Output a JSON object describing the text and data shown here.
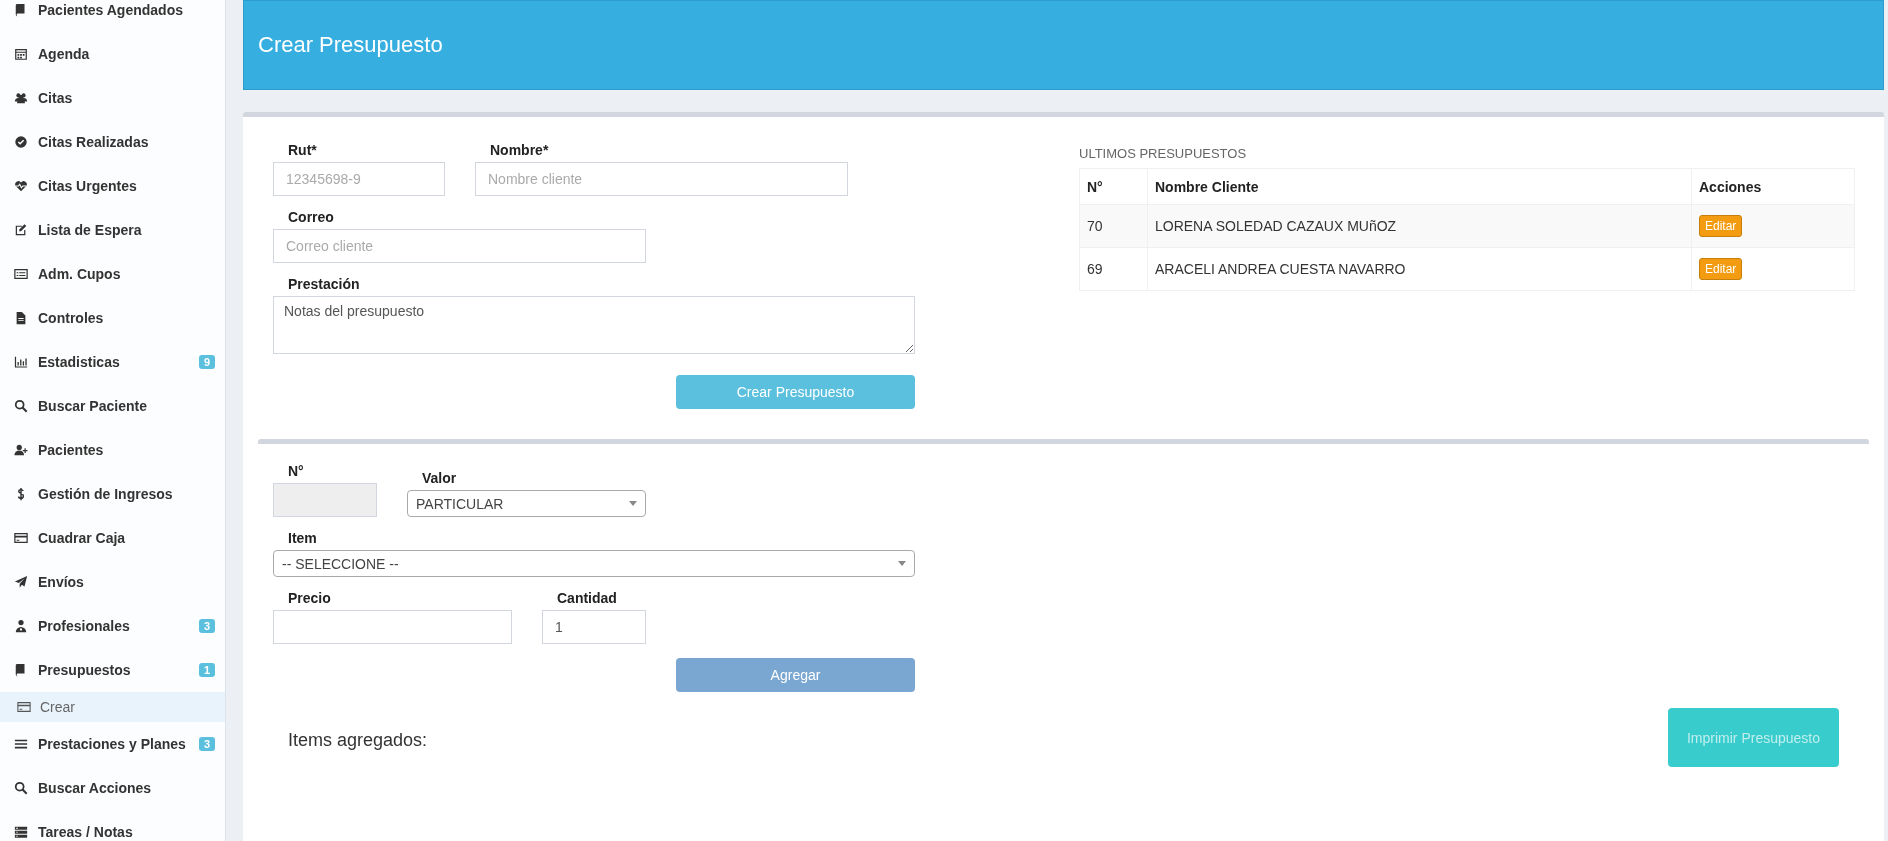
{
  "sidebar": {
    "items": [
      {
        "label": "Pacientes Agendados",
        "kind": "main",
        "selected": false
      },
      {
        "label": "Agenda",
        "kind": "main",
        "selected": false
      },
      {
        "label": "Citas",
        "kind": "main",
        "selected": false
      },
      {
        "label": "Citas Realizadas",
        "kind": "main",
        "selected": false
      },
      {
        "label": "Citas Urgentes",
        "kind": "main",
        "selected": false
      },
      {
        "label": "Lista de Espera",
        "kind": "main",
        "selected": false
      },
      {
        "label": "Adm. Cupos",
        "kind": "main",
        "selected": false
      },
      {
        "label": "Controles",
        "kind": "main",
        "selected": false
      },
      {
        "label": "Estadisticas",
        "kind": "main",
        "selected": false,
        "badge": "9"
      },
      {
        "label": "Buscar Paciente",
        "kind": "main",
        "selected": false
      },
      {
        "label": "Pacientes",
        "kind": "main",
        "selected": false
      },
      {
        "label": "Gestión de Ingresos",
        "kind": "main",
        "selected": false
      },
      {
        "label": "Cuadrar Caja",
        "kind": "main",
        "selected": false
      },
      {
        "label": "Envíos",
        "kind": "main",
        "selected": false
      },
      {
        "label": "Profesionales",
        "kind": "main",
        "selected": false,
        "badge": "3"
      },
      {
        "label": "Presupuestos",
        "kind": "main",
        "selected": false,
        "badge": "1"
      },
      {
        "label": "Crear",
        "kind": "sub",
        "selected": true
      },
      {
        "label": "Prestaciones y Planes",
        "kind": "main",
        "selected": false,
        "badge": "3"
      },
      {
        "label": "Buscar Acciones",
        "kind": "main",
        "selected": false
      },
      {
        "label": "Tareas / Notas",
        "kind": "main",
        "selected": false
      }
    ]
  },
  "header": {
    "title": "Crear Presupuesto"
  },
  "budget_form": {
    "rut": {
      "label": "Rut*",
      "placeholder": "12345698-9"
    },
    "nombre": {
      "label": "Nombre*",
      "placeholder": "Nombre cliente"
    },
    "correo": {
      "label": "Correo",
      "placeholder": "Correo cliente"
    },
    "prestacion": {
      "label": "Prestación",
      "value": "Notas del presupuesto"
    },
    "submit": {
      "label": "Crear Presupuesto",
      "disabled": false
    }
  },
  "recent": {
    "title": "ULTIMOS PRESUPUESTOS",
    "columns": [
      "N°",
      "Nombre Cliente",
      "Acciones"
    ],
    "rows": [
      {
        "number": "70",
        "client": "LORENA SOLEDAD CAZAUX MUñOZ",
        "action": "Editar"
      },
      {
        "number": "69",
        "client": "ARACELI ANDREA CUESTA NAVARRO",
        "action": "Editar"
      }
    ]
  },
  "item_form": {
    "numero": {
      "label": "N°",
      "disabled": true
    },
    "valor": {
      "label": "Valor",
      "value": "PARTICULAR"
    },
    "item": {
      "label": "Item",
      "value": "-- SELECCIONE --"
    },
    "precio": {
      "label": "Precio"
    },
    "cantidad": {
      "label": "Cantidad",
      "value": "1"
    },
    "add": {
      "label": "Agregar",
      "disabled": true
    },
    "items_title": "Items agregados:",
    "print": {
      "label": "Imprimir Presupuesto",
      "disabled": true
    }
  }
}
